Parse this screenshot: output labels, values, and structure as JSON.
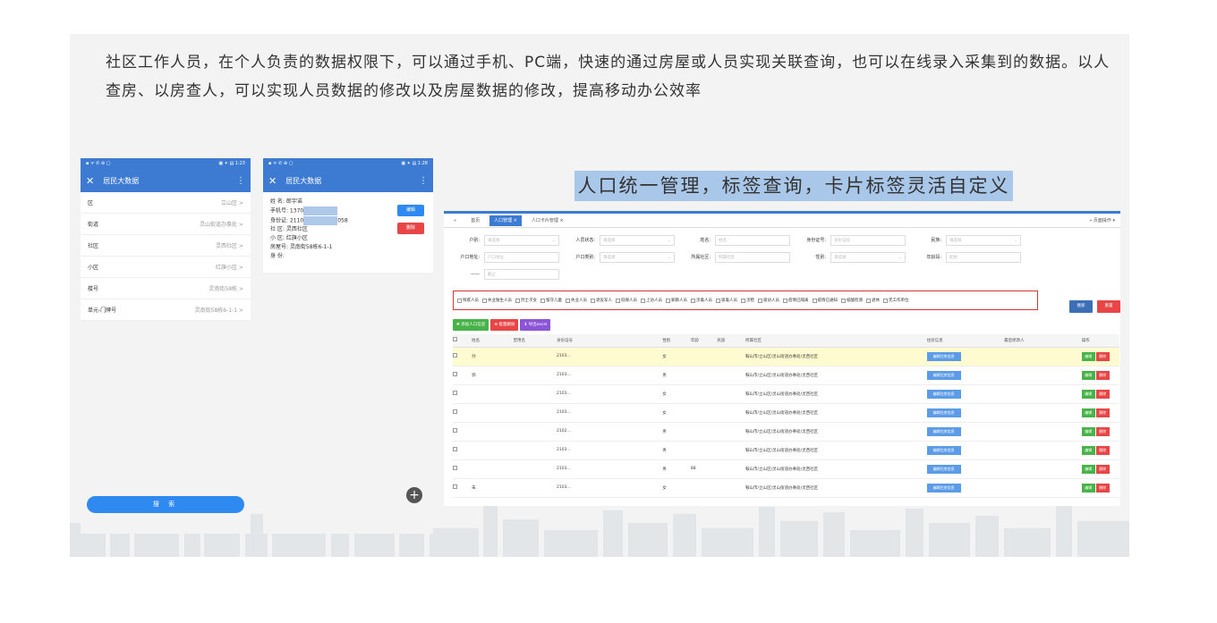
{
  "intro_text": "社区工作人员，在个人负责的数据权限下，可以通过手机、PC端，快速的通过房屋或人员实现关联查询，也可以在线录入采集到的数据。以人查房、以房查人，可以实现人员数据的修改以及房屋数据的修改，提高移动办公效率",
  "caption": "人口统一管理，标签查询，卡片标签灵活自定义",
  "phone1": {
    "status_left": "▪ ᯤ ✆ ⊕ ▢",
    "status_right": "▣ ✦ ▤ 1:23",
    "title": "居民大数据",
    "items": [
      {
        "label": "区",
        "value": "立山区"
      },
      {
        "label": "街道",
        "value": "灵山街道办事处"
      },
      {
        "label": "社区",
        "value": "灵西社区"
      },
      {
        "label": "小区",
        "value": "红旗小区"
      },
      {
        "label": "楼号",
        "value": "灵南街58栋"
      },
      {
        "label": "单元-门牌号",
        "value": "灵南街58栋6-1-1"
      }
    ],
    "search_label": "搜 索"
  },
  "phone2": {
    "status_left": "▪ ᯤ ✆ ⊕ ▢",
    "status_right": "▣ ✦ ▤ 1:28",
    "title": "居民大数据",
    "rows": [
      "姓  名: 郎宇诺",
      "手机号: 1370",
      "身份证: 2110",
      "社  区: 灵西社区",
      "小  区: 红旗小区",
      "房屋号: 灵南街58栋6-1-1",
      "身  份:"
    ],
    "id_suffix": "058",
    "edit_label": "编辑",
    "delete_label": "删除",
    "fab": "+"
  },
  "web": {
    "tabs": [
      "«",
      "首页",
      "人口管理 ×",
      "人口卡片管理 ×"
    ],
    "tabs_right": "»  页面操作 ▾",
    "form_rows": [
      [
        {
          "label": "户别:",
          "value": "请选择",
          "dd": true
        },
        {
          "label": "人员状态:",
          "value": "请选择",
          "dd": true
        },
        {
          "label": "姓名:",
          "value": "姓名"
        },
        {
          "label": "身份证号:",
          "value": "身份证号"
        },
        {
          "label": "民族:",
          "value": "请选择",
          "dd": true
        }
      ],
      [
        {
          "label": "户口地址:",
          "value": "户口地址"
        },
        {
          "label": "户口类别:",
          "value": "请选择",
          "dd": true
        },
        {
          "label": "所属社区:",
          "value": "所属社区"
        },
        {
          "label": "性别:",
          "value": "请选择",
          "dd": true
        },
        {
          "label": "年龄段:",
          "value": "起始"
        }
      ],
      [
        {
          "label": "——",
          "value": "截止"
        }
      ]
    ],
    "tags": [
      "残疾人员",
      "失业独生人员",
      "烈士子女",
      "留守儿童",
      "失业人员",
      "退役军人",
      "低保人员",
      "上访人员",
      "邪教人员",
      "涉毒人员",
      "吸毒人员",
      "涉稳",
      "吸访人员",
      "疫情已隔离",
      "疫情已通知",
      "核酸检测",
      "退休",
      "无工作单位"
    ],
    "search_btn": "搜索",
    "reset_btn": "重置",
    "actions": [
      "✚ 添加人口信息",
      "⊗ 批量删除",
      "⬇ 导出excel"
    ],
    "headers": [
      "",
      "姓名",
      "曾用名",
      "身份证号",
      "性别",
      "年龄",
      "民族",
      "所属社区",
      "住房信息",
      "最后修改人",
      "操作"
    ],
    "rows": [
      {
        "name": "孙",
        "id": "2103...",
        "sex": "女",
        "age": "",
        "community": "鞍山市/立山区/灵山街道办事处/灵西社区"
      },
      {
        "name": "郭",
        "id": "2103...",
        "sex": "男",
        "age": "",
        "community": "鞍山市/立山区/灵山街道办事处/灵西社区"
      },
      {
        "name": "",
        "id": "2103...",
        "sex": "女",
        "age": "",
        "community": "鞍山市/立山区/灵山街道办事处/灵西社区"
      },
      {
        "name": "",
        "id": "2103...",
        "sex": "女",
        "age": "",
        "community": "鞍山市/立山区/灵山街道办事处/灵西社区"
      },
      {
        "name": "",
        "id": "2102...",
        "sex": "男",
        "age": "",
        "community": "鞍山市/立山区/灵山街道办事处/灵西社区"
      },
      {
        "name": "",
        "id": "2103...",
        "sex": "男",
        "age": "",
        "community": "鞍山市/立山区/灵山街道办事处/灵西社区"
      },
      {
        "name": "",
        "id": "2103...",
        "sex": "男",
        "age": "88",
        "community": "鞍山市/立山区/灵山街道办事处/灵西社区"
      },
      {
        "name": "朱",
        "id": "2103...",
        "sex": "女",
        "age": "",
        "community": "鞍山市/立山区/灵山街道办事处/灵西社区"
      }
    ],
    "housing_btn": "编辑住房信息",
    "op_edit": "编辑",
    "op_delete": "删除"
  }
}
